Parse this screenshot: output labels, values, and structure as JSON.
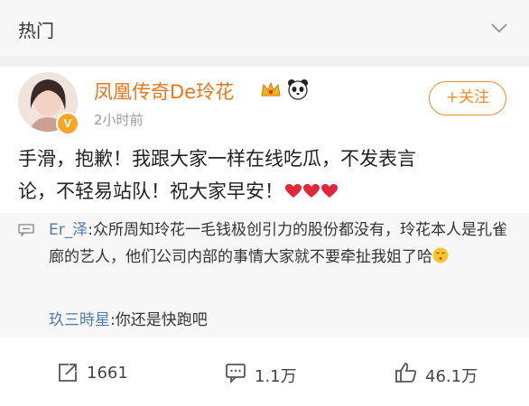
{
  "header": {
    "title": "热门",
    "chevron_icon": "chevron-down-icon"
  },
  "post": {
    "author": "凤凰传奇De玲花",
    "badges": [
      "crown-icon",
      "panda-icon"
    ],
    "verified_icon": "verified-v-icon",
    "time": "2小时前",
    "follow_label": "+关注",
    "text_line1": "手滑，抱歉！我跟大家一样在线吃瓜，不发表言",
    "text_line2": "论，不轻易站队！祝大家早安！",
    "text_emojis": [
      "heart-icon",
      "heart-icon",
      "heart-icon"
    ]
  },
  "comments": [
    {
      "user": "Er_泽",
      "text": ":众所周知玲花一毛钱极创引力的股份都没有，玲花本人是孔雀廊的艺人，他们公司内部的事情大家就不要牵扯我姐了哈",
      "emoji": "kiss-face-icon"
    },
    {
      "user": "玖三時星",
      "text": ":你还是快跑吧"
    }
  ],
  "actions": {
    "repost": "1661",
    "comment": "1.1万",
    "like": "46.1万"
  },
  "colors": {
    "accent": "#f08a24",
    "name": "#e8751a",
    "link": "#4f7cae",
    "heart": "#e0283a"
  }
}
